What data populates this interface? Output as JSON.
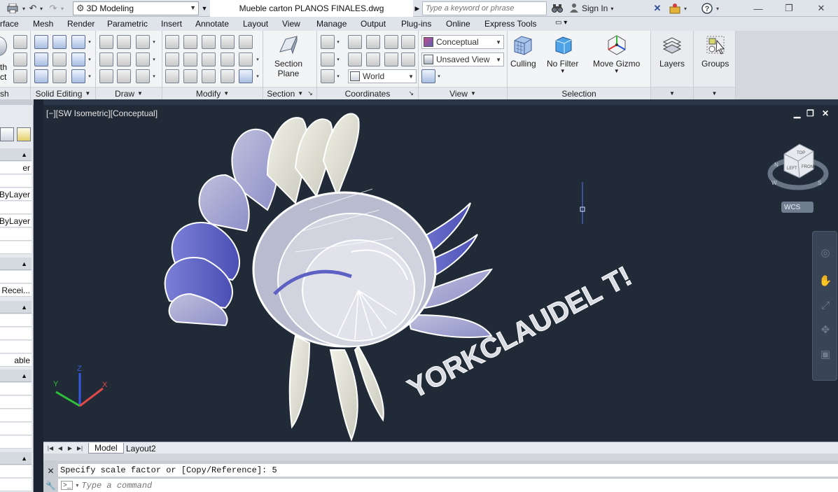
{
  "title_bar": {
    "workspace": "3D Modeling",
    "document_title": "Mueble carton PLANOS FINALES.dwg",
    "search_placeholder": "Type a keyword or phrase",
    "sign_in": "Sign In",
    "icons": [
      "print-icon",
      "undo-icon",
      "redo-icon",
      "binoculars-icon",
      "user-icon",
      "exchange-icon",
      "autodesk-app-icon",
      "help-icon",
      "minimize-icon",
      "restore-icon",
      "close-icon"
    ]
  },
  "menu_tabs": [
    "rface",
    "Mesh",
    "Render",
    "Parametric",
    "Insert",
    "Annotate",
    "Layout",
    "View",
    "Manage",
    "Output",
    "Plug-ins",
    "Online",
    "Express Tools"
  ],
  "ribbon": {
    "panels": {
      "mesh_partial": "sh",
      "mesh_big_line1": "th",
      "mesh_big_line2": "ct",
      "solid_editing": "Solid Editing",
      "draw": "Draw",
      "modify": "Modify",
      "section": "Section",
      "coordinates": "Coordinates",
      "view": "View",
      "selection": "Selection"
    },
    "section_plane": {
      "line1": "Section",
      "line2": "Plane"
    },
    "visual_style": "Conceptual",
    "view_name": "Unsaved View",
    "ucs": "World",
    "buttons": {
      "culling": "Culling",
      "no_filter": "No Filter",
      "move_gizmo": "Move Gizmo",
      "layers": "Layers",
      "groups": "Groups"
    }
  },
  "left_palette": {
    "rows": [
      "er",
      "ByLayer",
      "ByLayer",
      "Recei...",
      "able"
    ]
  },
  "viewport": {
    "label": "[−][SW Isometric][Conceptual]",
    "model_text": "YORKCLAUDEL T!",
    "wcs": "WCS",
    "viewcube": {
      "top": "TOP",
      "left": "LEFT",
      "front": "FRONT",
      "n": "N",
      "w": "W",
      "s": "S"
    },
    "ucs_axes": {
      "x": "X",
      "y": "Y",
      "z": "Z"
    },
    "colors": {
      "background": "#212b38",
      "petal_light": "#e6e6d6",
      "petal_blue": "#5f63c9",
      "accent_red": "#e14848",
      "accent_green": "#2fbf39",
      "accent_blue": "#3658e0"
    }
  },
  "layout_tabs": [
    "Model",
    "Layout2"
  ],
  "command": {
    "history": "Specify scale factor or [Copy/Reference]: 5",
    "placeholder": "Type a command"
  }
}
